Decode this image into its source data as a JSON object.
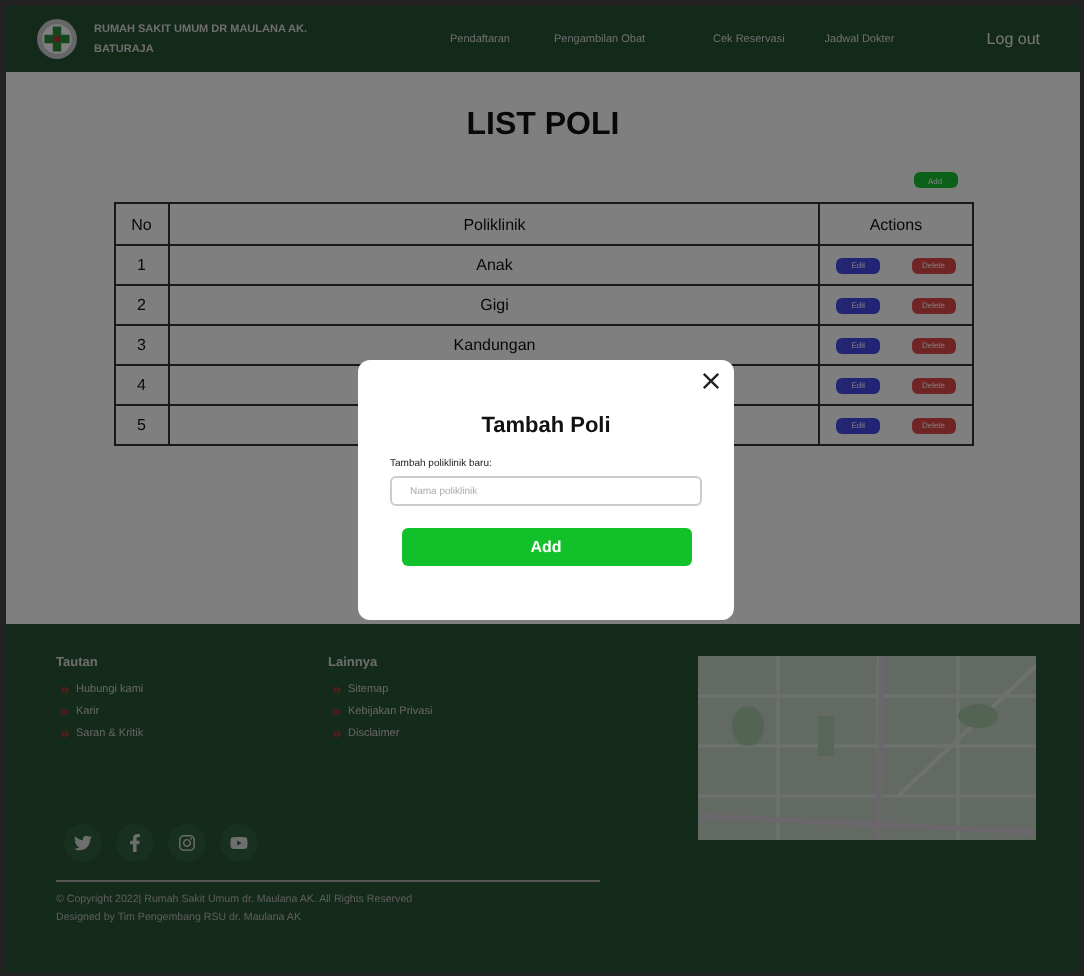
{
  "header": {
    "title": "RUMAH SAKIT UMUM DR MAULANA AK. BATURAJA",
    "nav": [
      "Pendaftaran",
      "Pengambilan Obat",
      "Cek Reservasi",
      "Jadwal Dokter"
    ],
    "logout": "Log out"
  },
  "page": {
    "title": "LIST POLI",
    "add_button": "Add"
  },
  "table": {
    "columns": [
      "No",
      "Poliklinik",
      "Actions"
    ],
    "rows": [
      {
        "no": "1",
        "name": "Anak",
        "edit": "Edit",
        "delete": "Delete"
      },
      {
        "no": "2",
        "name": "Gigi",
        "edit": "Edit",
        "delete": "Delete"
      },
      {
        "no": "3",
        "name": "Kandungan",
        "edit": "Edit",
        "delete": "Delete"
      },
      {
        "no": "4",
        "edit": "Edit",
        "delete": "Delete"
      },
      {
        "no": "5",
        "edit": "Edit",
        "delete": "Delete"
      }
    ]
  },
  "modal": {
    "title": "Tambah Poli",
    "label": "Tambah poliklinik baru:",
    "placeholder": "Nama poliklinik",
    "submit": "Add"
  },
  "footer": {
    "columns": [
      {
        "title": "Tautan",
        "links": [
          "Hubungi kami",
          "Karir",
          "Saran & Kritik"
        ]
      },
      {
        "title": "Lainnya",
        "links": [
          "Sitemap",
          "Kebijakan Privasi",
          "Disclaimer"
        ]
      }
    ],
    "copyright": "© Copyright 2022| Rumah Sakit Umum dr. Maulana AK. All Rights Reserved",
    "designed": "Designed by Tim Pengembang RSU dr. Maulana AK"
  }
}
